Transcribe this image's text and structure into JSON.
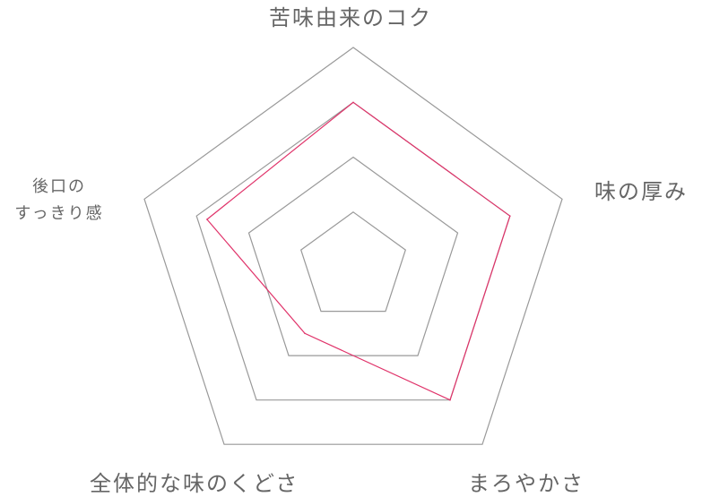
{
  "chart_data": {
    "type": "radar",
    "axes": [
      {
        "key": "bitterness",
        "label": "苦味由来のコク"
      },
      {
        "key": "thickness",
        "label": "味の厚み"
      },
      {
        "key": "mellowness",
        "label": "まろやかさ"
      },
      {
        "key": "overall",
        "label": "全体的な味のくどさ"
      },
      {
        "key": "aftertaste",
        "label_lines": [
          "後口の",
          "すっきり感"
        ]
      }
    ],
    "levels": 4,
    "max": 4,
    "series": [
      {
        "values": [
          3.0,
          3.0,
          3.0,
          1.5,
          2.8
        ],
        "color": "#e0336a"
      }
    ],
    "grid_color": "#999999"
  }
}
